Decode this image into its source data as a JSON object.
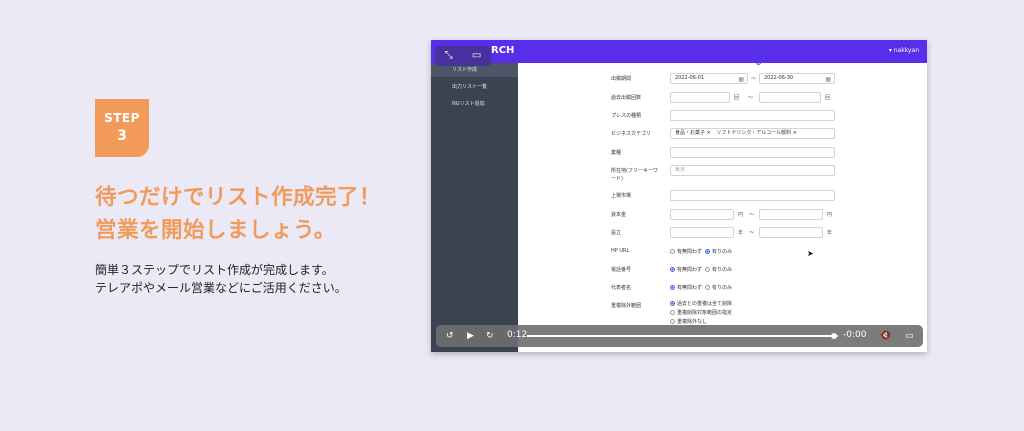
{
  "step": {
    "label": "STEP",
    "number": "3"
  },
  "headline": {
    "line1": "待つだけでリスト作成完了！",
    "line2": "営業を開始しましょう。"
  },
  "body": {
    "line1": "簡単３ステップでリスト作成が完成します。",
    "line2": "テレアポやメール営業などにご活用ください。"
  },
  "video": {
    "app_title": "RCH",
    "user": "▾ nakkyan",
    "sidebar": [
      "リスト作成",
      "出力リスト一覧",
      "NGリスト追加"
    ],
    "form": {
      "top_partial": "",
      "rows": {
        "period": {
          "label": "出稿期間",
          "from": "2022-06-01",
          "sep": "〜",
          "to": "2022-06-30"
        },
        "count": {
          "label": "過去出稿回数",
          "unit1": "回",
          "sep": "〜",
          "unit2": "回"
        },
        "press": {
          "label": "プレスの種類"
        },
        "category": {
          "label": "ビジネスカテゴリ",
          "tags": [
            "食品・お菓子 ×",
            "ソフトドリンク・アルコール飲料 ×"
          ]
        },
        "industry": {
          "label": "業種"
        },
        "location": {
          "label": "所在地(フリーキーワード)",
          "placeholder": "東京"
        },
        "listed": {
          "label": "上場市場"
        },
        "capital": {
          "label": "資本金",
          "unit1": "円",
          "sep": "〜",
          "unit2": "円"
        },
        "founded": {
          "label": "設立",
          "unit1": "年",
          "sep": "〜",
          "unit2": "年"
        },
        "hp": {
          "label": "HP URL",
          "opt1": "有無問わず",
          "opt2": "有りのみ"
        },
        "phone": {
          "label": "電話番号",
          "opt1": "有無問わず",
          "opt2": "有りのみ"
        },
        "rep": {
          "label": "代表者名",
          "opt1": "有無問わず",
          "opt2": "有りのみ"
        },
        "duplicate": {
          "label": "重複除外範囲",
          "opts": [
            "過去との重複は全て削除",
            "重複削除対象範囲の指定",
            "重複除外なし"
          ]
        }
      }
    },
    "player": {
      "current": "0:12",
      "remaining": "-0:00",
      "progress": 0.985
    }
  }
}
